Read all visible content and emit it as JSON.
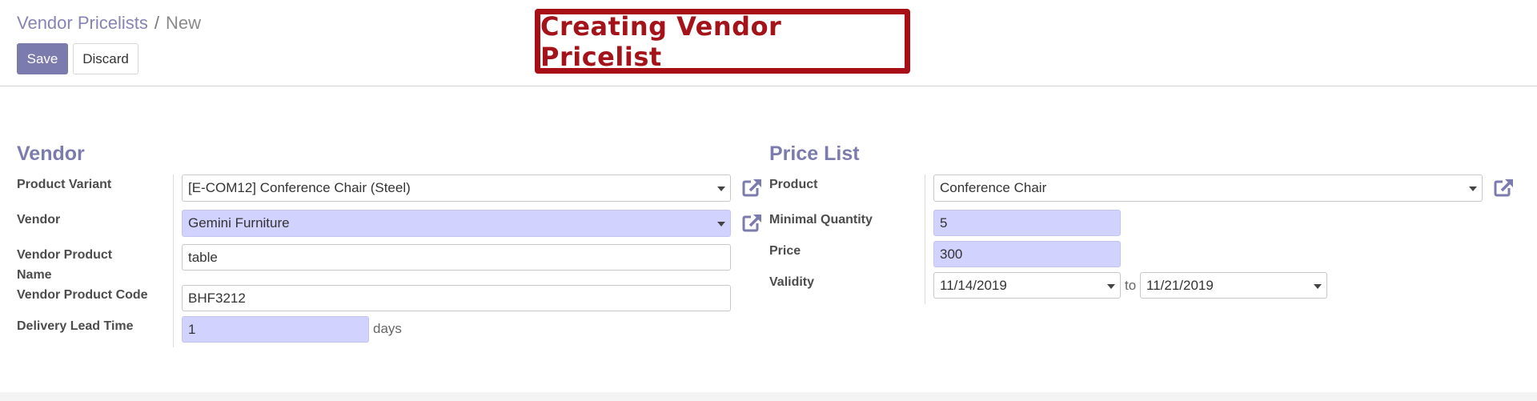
{
  "breadcrumb": {
    "parent": "Vendor Pricelists",
    "separator": "/",
    "current": "New"
  },
  "toolbar": {
    "save_label": "Save",
    "discard_label": "Discard"
  },
  "banner": {
    "text": "Creating Vendor Pricelist"
  },
  "vendor_group": {
    "title": "Vendor",
    "product_variant": {
      "label": "Product Variant",
      "value": "[E-COM12] Conference Chair (Steel)"
    },
    "vendor": {
      "label": "Vendor",
      "value": "Gemini Furniture"
    },
    "vendor_product_name": {
      "label_line1": "Vendor Product",
      "label_line2": "Name",
      "value": "table"
    },
    "vendor_product_code": {
      "label": "Vendor Product Code",
      "value": "BHF3212"
    },
    "delivery_lead_time": {
      "label": "Delivery Lead Time",
      "value": "1",
      "unit": "days"
    }
  },
  "pricelist_group": {
    "title": "Price List",
    "product": {
      "label": "Product",
      "value": "Conference Chair"
    },
    "minimal_quantity": {
      "label": "Minimal Quantity",
      "value": "5"
    },
    "price": {
      "label": "Price",
      "value": "300"
    },
    "validity": {
      "label": "Validity",
      "date_from": "11/14/2019",
      "to_label": "to",
      "date_to": "11/21/2019"
    }
  },
  "colors": {
    "accent": "#7c7bad",
    "required_bg": "#d2d2ff",
    "banner_red": "#a80e16"
  },
  "icons": {
    "external_link": "external-link-icon",
    "dropdown": "chevron-down-icon"
  }
}
